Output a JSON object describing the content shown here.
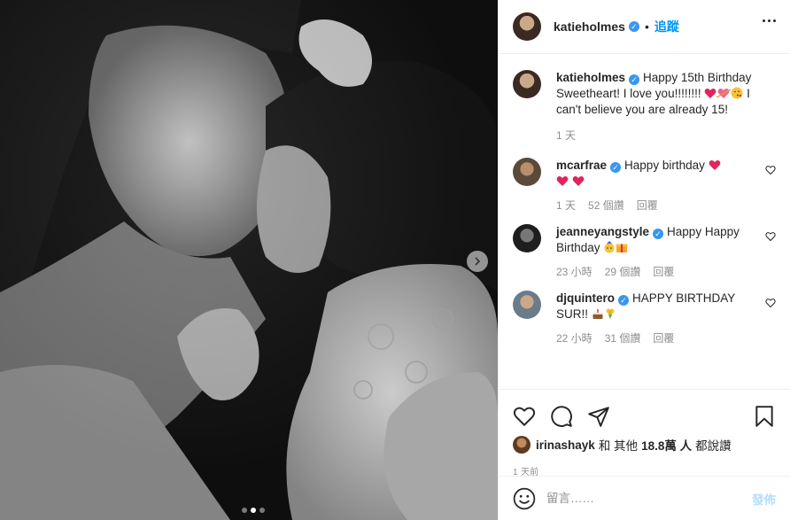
{
  "photo": {
    "alt": "",
    "carousel_dots": 3,
    "active_dot": 1
  },
  "author": {
    "username": "katieholmes",
    "follow_label": "追蹤",
    "separator": "•"
  },
  "caption": {
    "username": "katieholmes",
    "text_1": "Happy 15th Birthday Sweetheart! I love you!!!!!!!! ",
    "text_2": " I can't believe you are already 15!",
    "age": "1 天"
  },
  "comments": [
    {
      "username": "mcarfrae",
      "text": "Happy birthday ",
      "age": "1 天",
      "likes": "52 個讚",
      "reply": "回覆"
    },
    {
      "username": "jeanneyangstyle",
      "text": "Happy Happy Birthday ",
      "age": "23 小時",
      "likes": "29 個讚",
      "reply": "回覆"
    },
    {
      "username": "djquintero",
      "text": "HAPPY BIRTHDAY SUR!! ",
      "age": "22 小時",
      "likes": "31 個讚",
      "reply": "回覆"
    }
  ],
  "likes_line": {
    "username": "irinashayk",
    "mid": "和 其他",
    "count": "18.8萬 人",
    "suffix": "都說讚"
  },
  "posted": "1 天前",
  "add_comment": {
    "placeholder": "留言……",
    "post_label": "發佈"
  },
  "icons": {
    "like": "heart-outline-icon",
    "comment": "speech-bubble-icon",
    "share": "paper-plane-icon",
    "save": "bookmark-icon",
    "emoji": "smiley-icon",
    "more": "ellipsis-icon",
    "next": "chevron-right-icon",
    "verified": "verified-badge-icon"
  },
  "colors": {
    "link_blue": "#0095f6",
    "verified": "#3897f0",
    "muted": "#8e8e8e",
    "post_disabled": "#b2dffc",
    "heart_red": "#e0245e"
  }
}
